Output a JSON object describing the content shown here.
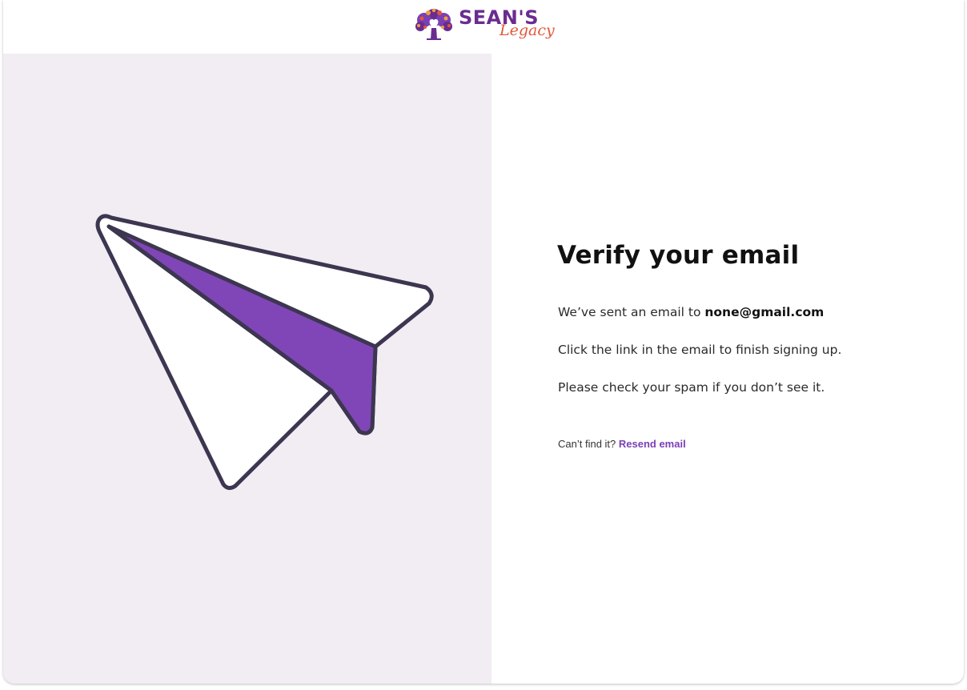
{
  "brand": {
    "name": "SEAN'S",
    "script": "Legacy",
    "colors": {
      "purple": "#6a2c91",
      "accent": "#e2573a",
      "panel_bg": "#f2ecf3",
      "link": "#7b3fb5"
    }
  },
  "illustration": {
    "icon": "paper-plane-icon"
  },
  "content": {
    "title": "Verify your email",
    "sent_prefix": "We’ve sent an email to ",
    "email": "none@gmail.com",
    "instruction": "Click the link in the email to finish signing up.",
    "spam_note": "Please check your spam if you don’t see it.",
    "resend_prompt": "Can’t find it? ",
    "resend_label": "Resend email"
  }
}
